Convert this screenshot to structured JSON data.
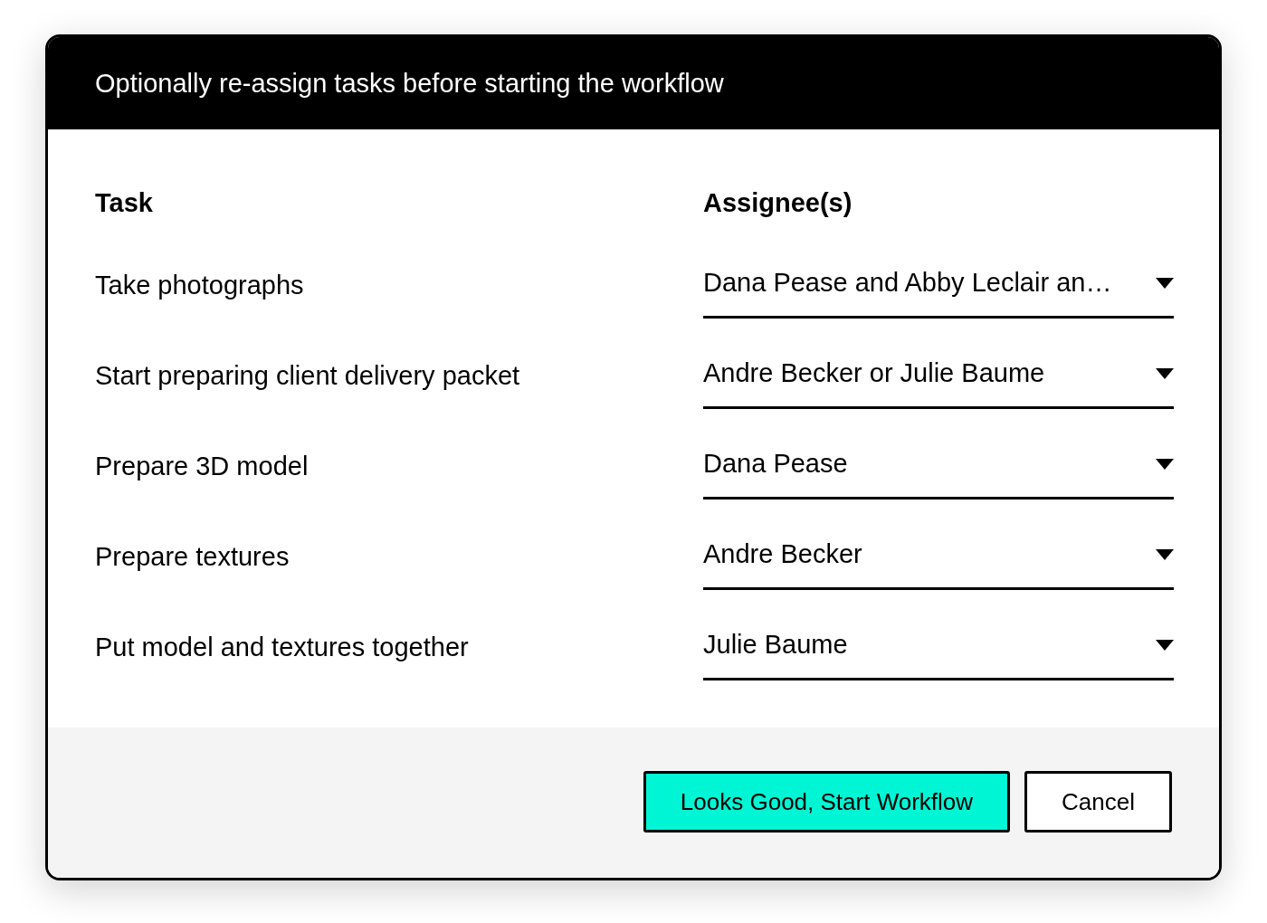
{
  "dialog": {
    "title": "Optionally re-assign tasks before starting the workflow",
    "columns": [
      "Task",
      "Assignee(s)"
    ],
    "rows": [
      {
        "task": "Take photographs",
        "assignee": "Dana Pease and Abby Leclair an…"
      },
      {
        "task": "Start preparing client delivery packet",
        "assignee": "Andre Becker or Julie Baume"
      },
      {
        "task": "Prepare 3D model",
        "assignee": "Dana Pease"
      },
      {
        "task": "Prepare textures",
        "assignee": "Andre Becker"
      },
      {
        "task": "Put model and textures together",
        "assignee": "Julie Baume"
      }
    ],
    "buttons": [
      {
        "label": "Looks Good, Start Workflow",
        "kind": "primary"
      },
      {
        "label": "Cancel",
        "kind": "secondary"
      }
    ]
  }
}
